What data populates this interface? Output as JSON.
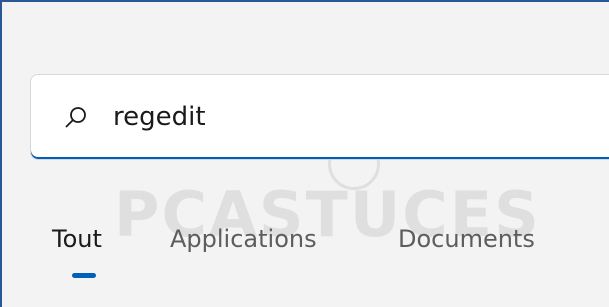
{
  "search": {
    "value": "regedit",
    "icon": "search-icon"
  },
  "tabs": [
    {
      "label": "Tout",
      "selected": true
    },
    {
      "label": "Applications",
      "selected": false
    },
    {
      "label": "Documents",
      "selected": false
    }
  ],
  "watermark": {
    "text": "PCASTUCES"
  },
  "colors": {
    "accent": "#005fb8",
    "frame_border": "#2b5797",
    "background": "#f3f3f3"
  }
}
